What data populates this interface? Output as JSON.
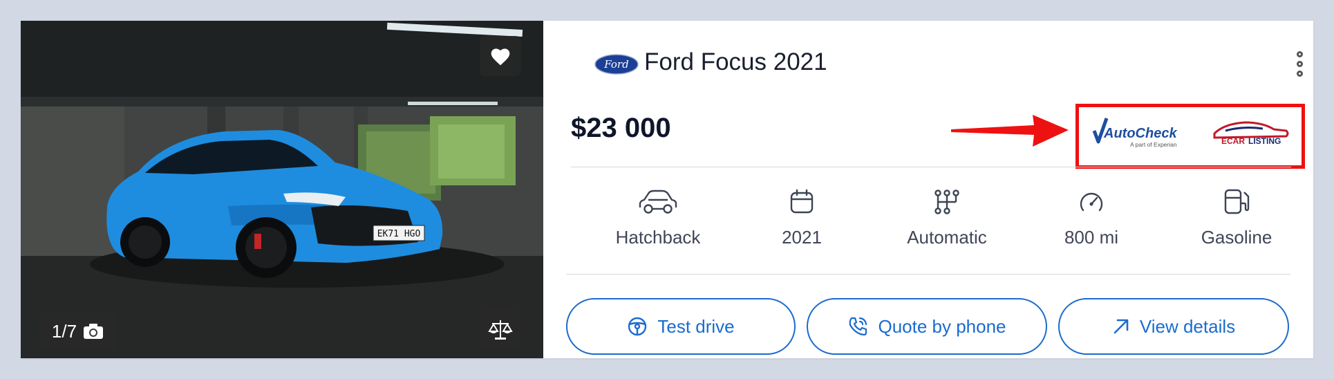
{
  "listing": {
    "title": "Ford Focus 2021",
    "price": "$23 000",
    "brand_logo_text": "Ford",
    "plate_text": "EK71 HGO",
    "photo_counter": "1/7"
  },
  "badges": {
    "autocheck_name": "AutoCheck",
    "autocheck_sub": "A part of Experian",
    "ecar_name_a": "ECAR",
    "ecar_name_b": "LISTING"
  },
  "specs": [
    {
      "icon": "car-body-icon",
      "label": "Hatchback"
    },
    {
      "icon": "calendar-icon",
      "label": "2021"
    },
    {
      "icon": "gearbox-icon",
      "label": "Automatic"
    },
    {
      "icon": "speedometer-icon",
      "label": "800 mi"
    },
    {
      "icon": "fuel-icon",
      "label": "Gasoline"
    }
  ],
  "actions": {
    "test_drive": "Test drive",
    "quote_by_phone": "Quote by phone",
    "view_details": "View details"
  },
  "colors": {
    "accent": "#1a6bcf",
    "highlight_box": "#ee1111",
    "car_paint": "#1e8de0"
  }
}
